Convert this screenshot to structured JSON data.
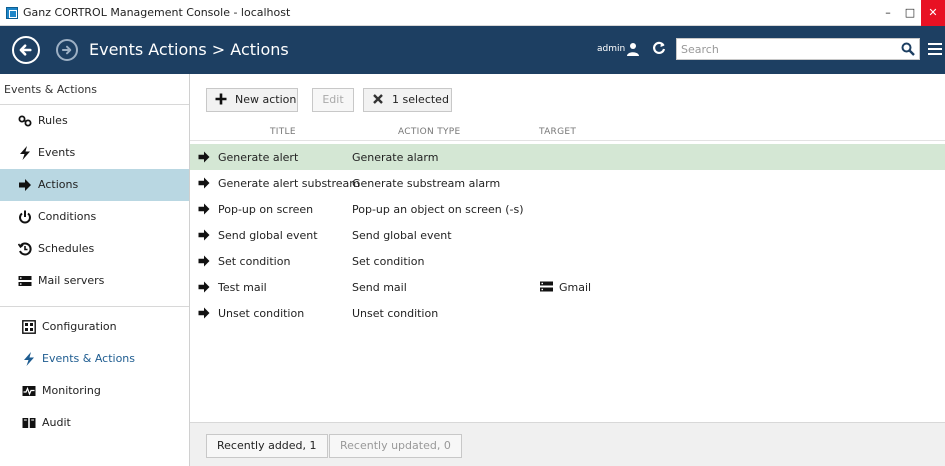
{
  "window": {
    "title": "Ganz CORTROL Management Console - localhost",
    "minimize": "–",
    "maximize": "□",
    "close": "✕"
  },
  "header": {
    "breadcrumb": "Events  Actions > Actions",
    "user": "admin",
    "search_placeholder": "Search",
    "bg_color": "#1d3f62"
  },
  "sidebar": {
    "heading": "Events & Actions",
    "items": [
      {
        "label": "Rules",
        "icon": "rules-icon"
      },
      {
        "label": "Events",
        "icon": "lightning-icon"
      },
      {
        "label": "Actions",
        "icon": "arrow-right-icon",
        "active": true
      },
      {
        "label": "Conditions",
        "icon": "power-icon"
      },
      {
        "label": "Schedules",
        "icon": "schedule-icon"
      },
      {
        "label": "Mail servers",
        "icon": "server-icon"
      }
    ],
    "sections": [
      {
        "label": "Configuration",
        "icon": "configuration-icon"
      },
      {
        "label": "Events & Actions",
        "icon": "lightning-icon",
        "current": true
      },
      {
        "label": "Monitoring",
        "icon": "monitoring-icon"
      },
      {
        "label": "Audit",
        "icon": "audit-icon"
      }
    ]
  },
  "toolbar": {
    "new_action": "New action",
    "edit": "Edit",
    "selected": "1 selected"
  },
  "table": {
    "columns": [
      "TITLE",
      "ACTION TYPE",
      "TARGET"
    ],
    "rows": [
      {
        "title": "Generate alert",
        "type": "Generate alarm",
        "target": "",
        "selected": true
      },
      {
        "title": "Generate alert substream",
        "type": "Generate substream alarm",
        "target": ""
      },
      {
        "title": "Pop-up on screen",
        "type": "Pop-up an object on screen (-s)",
        "target": ""
      },
      {
        "title": "Send global event",
        "type": "Send global event",
        "target": ""
      },
      {
        "title": "Set condition",
        "type": "Set condition",
        "target": ""
      },
      {
        "title": "Test mail",
        "type": "Send mail",
        "target": "Gmail"
      },
      {
        "title": "Unset condition",
        "type": "Unset condition",
        "target": ""
      }
    ]
  },
  "footer": {
    "recently_added": "Recently added, 1",
    "recently_updated": "Recently updated, 0"
  },
  "colors": {
    "active_sidebar": "#b9d7e2",
    "selected_row": "#d4e7d4",
    "close_button": "#e81123"
  }
}
